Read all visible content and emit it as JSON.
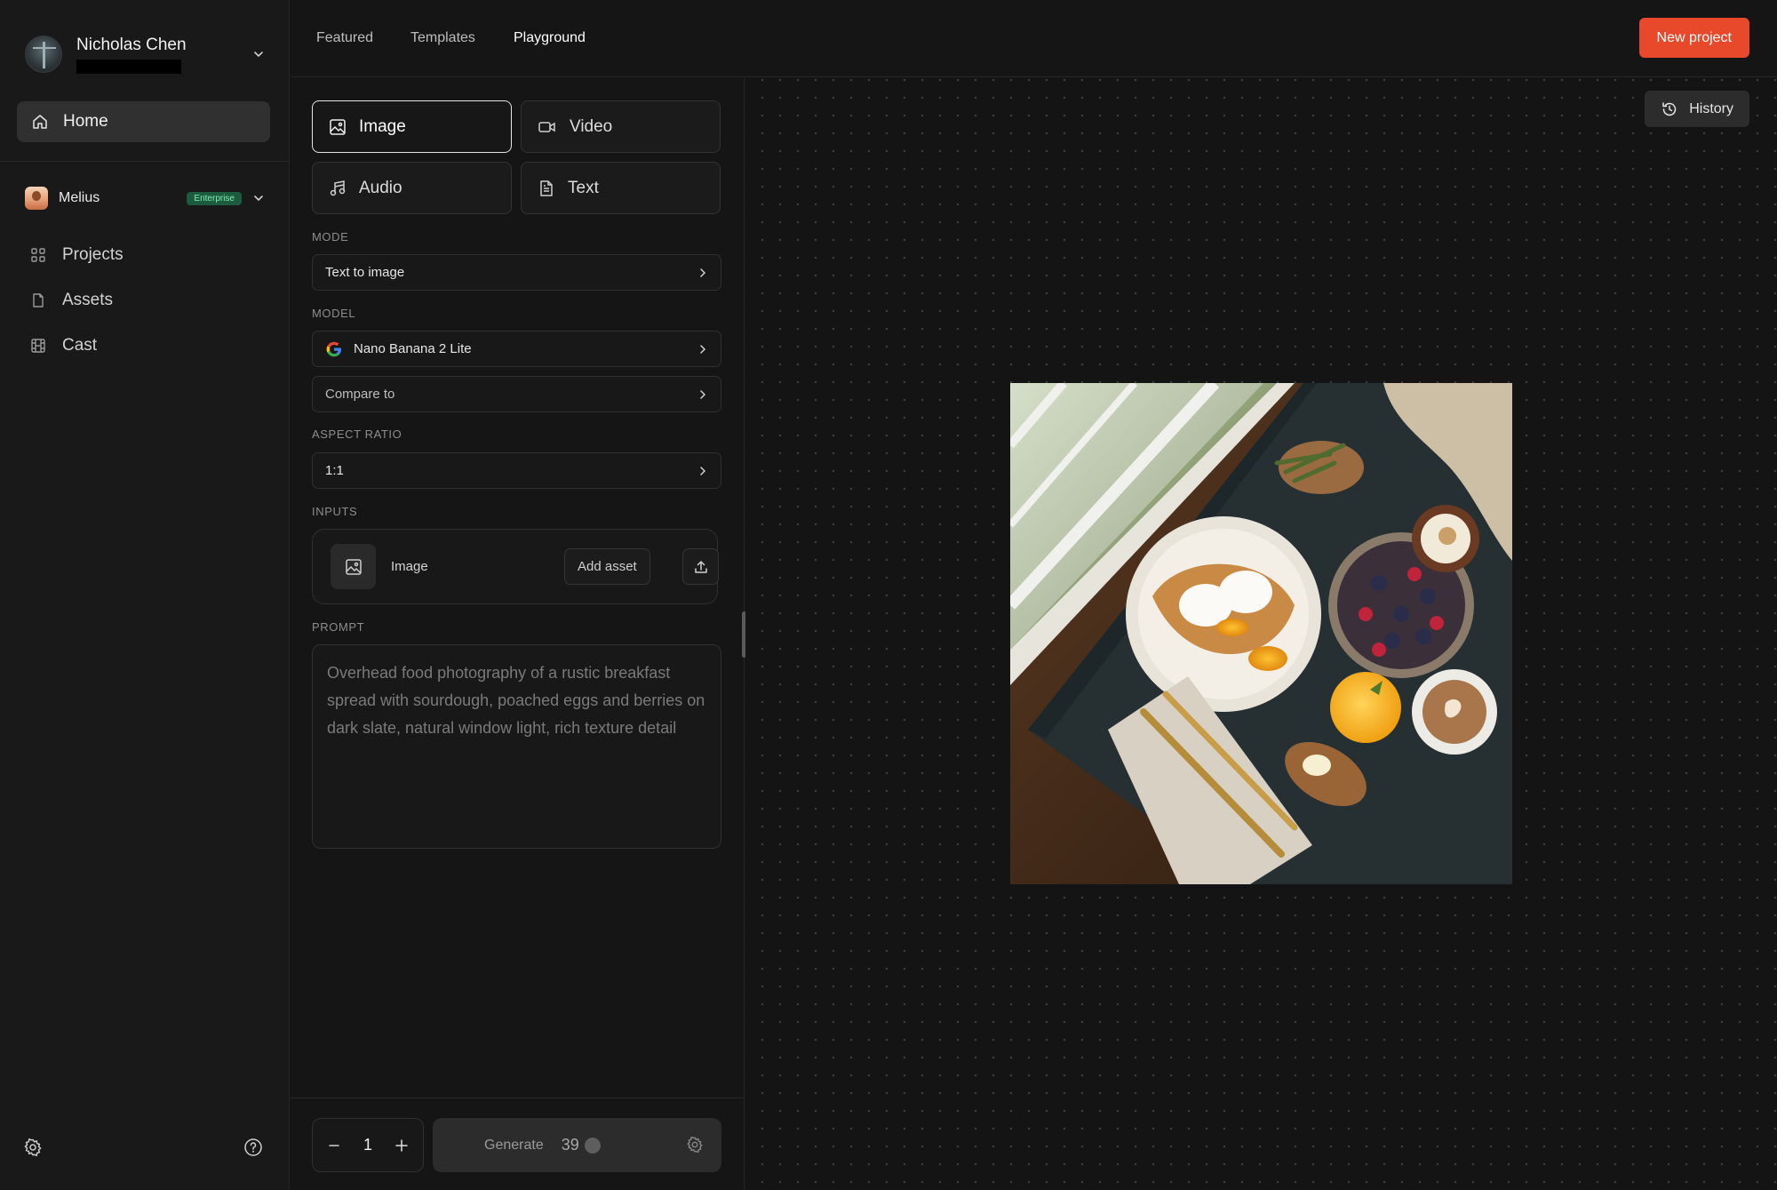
{
  "sidebar": {
    "user_name": "Nicholas Chen",
    "home_label": "Home",
    "workspace": {
      "name": "Melius",
      "badge": "Enterprise"
    },
    "nav_items": [
      {
        "label": "Projects",
        "icon": "grid-icon"
      },
      {
        "label": "Assets",
        "icon": "file-icon"
      },
      {
        "label": "Cast",
        "icon": "film-icon"
      }
    ]
  },
  "topbar": {
    "tabs": [
      "Featured",
      "Templates",
      "Playground"
    ],
    "active_tab": "Playground",
    "new_project_label": "New project"
  },
  "panel": {
    "types": [
      {
        "label": "Image",
        "icon": "image-icon",
        "active": true
      },
      {
        "label": "Video",
        "icon": "video-icon",
        "active": false
      },
      {
        "label": "Audio",
        "icon": "music-icon",
        "active": false
      },
      {
        "label": "Text",
        "icon": "document-icon",
        "active": false
      }
    ],
    "mode_label": "MODE",
    "mode_value": "Text to image",
    "model_label": "MODEL",
    "model_value": "Nano Banana 2 Lite",
    "compare_label": "Compare to",
    "aspect_label": "ASPECT RATIO",
    "aspect_value": "1:1",
    "inputs_label": "INPUTS",
    "input_image_label": "Image",
    "add_asset_label": "Add asset",
    "prompt_label": "PROMPT",
    "prompt_placeholder": "Overhead food photography of a rustic breakfast spread with sourdough, poached eggs and berries on dark slate, natural window light, rich texture detail",
    "count": "1",
    "generate_label": "Generate",
    "generate_cost": "39"
  },
  "canvas": {
    "history_label": "History"
  },
  "colors": {
    "accent": "#e8492a",
    "badge_bg": "#1d5b3e",
    "badge_text": "#7ff0b4"
  }
}
